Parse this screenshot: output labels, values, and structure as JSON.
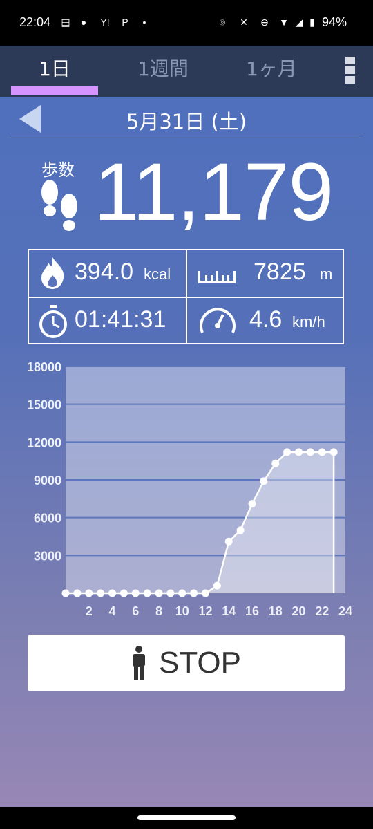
{
  "status": {
    "time": "22:04",
    "battery": "94%",
    "icons": [
      "calendar-icon",
      "line-icon",
      "yahoo-icon",
      "paypay-icon",
      "dot-icon",
      "location-icon",
      "mute-icon",
      "dnd-icon",
      "wifi-icon",
      "signal-icon",
      "battery-icon"
    ]
  },
  "tabs": [
    {
      "label": "1日",
      "active": true
    },
    {
      "label": "1週間",
      "active": false
    },
    {
      "label": "1ヶ月",
      "active": false
    }
  ],
  "date": "5月31日 (土)",
  "steps": {
    "label": "歩数",
    "value": "11,179"
  },
  "stats": {
    "calories": {
      "value": "394.0",
      "unit": "kcal"
    },
    "distance": {
      "value": "7825",
      "unit": "m"
    },
    "time": {
      "value": "01:41:31"
    },
    "speed": {
      "value": "4.6",
      "unit": "km/h"
    }
  },
  "chart_data": {
    "type": "area",
    "x": [
      0,
      1,
      2,
      3,
      4,
      5,
      6,
      7,
      8,
      9,
      10,
      11,
      12,
      13,
      14,
      15,
      16,
      17,
      18,
      19,
      20,
      21,
      22,
      23
    ],
    "values": [
      0,
      0,
      0,
      0,
      0,
      0,
      0,
      0,
      0,
      0,
      0,
      0,
      0,
      600,
      4100,
      5000,
      7100,
      8900,
      10300,
      11200,
      11200,
      11200,
      11200,
      11200
    ],
    "xticks": [
      "2",
      "4",
      "6",
      "8",
      "10",
      "12",
      "14",
      "16",
      "18",
      "20",
      "22",
      "24"
    ],
    "yticks": [
      "18000",
      "15000",
      "12000",
      "9000",
      "6000",
      "3000"
    ],
    "ylim": [
      0,
      18000
    ],
    "xlim": [
      0,
      24
    ]
  },
  "stop_button": {
    "label": "STOP"
  },
  "colors": {
    "tab_accent": "#d594ff",
    "tab_bar": "#2d3a57"
  }
}
